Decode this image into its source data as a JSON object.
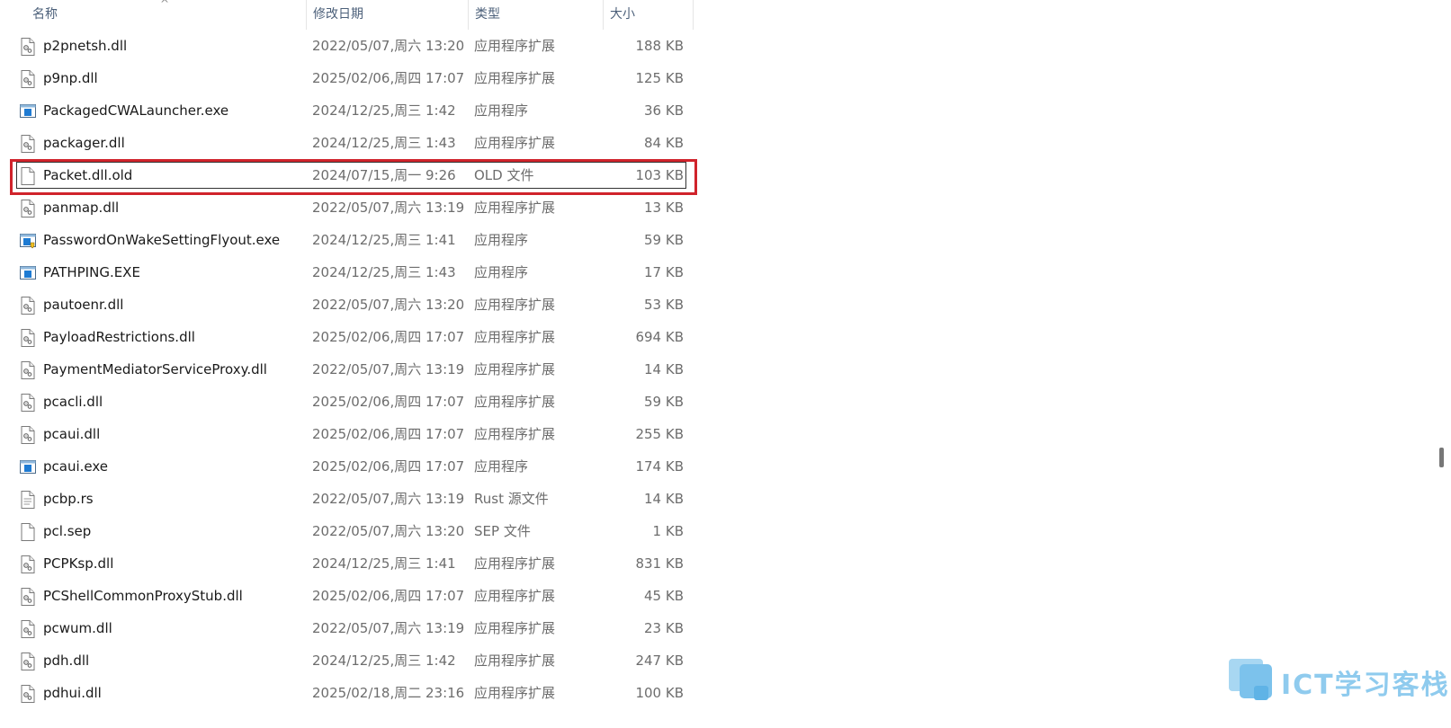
{
  "columns": {
    "name": "名称",
    "date": "修改日期",
    "type": "类型",
    "size": "大小"
  },
  "sort_indicator": "^",
  "files": [
    {
      "name": "p2pnetsh.dll",
      "date": "2022/05/07,周六 13:20",
      "type": "应用程序扩展",
      "size": "188 KB",
      "icon": "dll-icon"
    },
    {
      "name": "p9np.dll",
      "date": "2025/02/06,周四 17:07",
      "type": "应用程序扩展",
      "size": "125 KB",
      "icon": "dll-icon"
    },
    {
      "name": "PackagedCWALauncher.exe",
      "date": "2024/12/25,周三 1:42",
      "type": "应用程序",
      "size": "36 KB",
      "icon": "exe-icon"
    },
    {
      "name": "packager.dll",
      "date": "2024/12/25,周三 1:43",
      "type": "应用程序扩展",
      "size": "84 KB",
      "icon": "dll-icon"
    },
    {
      "name": "Packet.dll.old",
      "date": "2024/07/15,周一 9:26",
      "type": "OLD 文件",
      "size": "103 KB",
      "icon": "blank-file-icon",
      "selected": true
    },
    {
      "name": "panmap.dll",
      "date": "2022/05/07,周六 13:19",
      "type": "应用程序扩展",
      "size": "13 KB",
      "icon": "dll-icon"
    },
    {
      "name": "PasswordOnWakeSettingFlyout.exe",
      "date": "2024/12/25,周三 1:41",
      "type": "应用程序",
      "size": "59 KB",
      "icon": "exe-shield-icon"
    },
    {
      "name": "PATHPING.EXE",
      "date": "2024/12/25,周三 1:43",
      "type": "应用程序",
      "size": "17 KB",
      "icon": "exe-icon"
    },
    {
      "name": "pautoenr.dll",
      "date": "2022/05/07,周六 13:20",
      "type": "应用程序扩展",
      "size": "53 KB",
      "icon": "dll-icon"
    },
    {
      "name": "PayloadRestrictions.dll",
      "date": "2025/02/06,周四 17:07",
      "type": "应用程序扩展",
      "size": "694 KB",
      "icon": "dll-icon"
    },
    {
      "name": "PaymentMediatorServiceProxy.dll",
      "date": "2022/05/07,周六 13:19",
      "type": "应用程序扩展",
      "size": "14 KB",
      "icon": "dll-icon"
    },
    {
      "name": "pcacli.dll",
      "date": "2025/02/06,周四 17:07",
      "type": "应用程序扩展",
      "size": "59 KB",
      "icon": "dll-icon"
    },
    {
      "name": "pcaui.dll",
      "date": "2025/02/06,周四 17:07",
      "type": "应用程序扩展",
      "size": "255 KB",
      "icon": "dll-icon"
    },
    {
      "name": "pcaui.exe",
      "date": "2025/02/06,周四 17:07",
      "type": "应用程序",
      "size": "174 KB",
      "icon": "exe-icon"
    },
    {
      "name": "pcbp.rs",
      "date": "2022/05/07,周六 13:19",
      "type": "Rust 源文件",
      "size": "14 KB",
      "icon": "text-file-icon"
    },
    {
      "name": "pcl.sep",
      "date": "2022/05/07,周六 13:20",
      "type": "SEP 文件",
      "size": "1 KB",
      "icon": "blank-file-icon"
    },
    {
      "name": "PCPKsp.dll",
      "date": "2024/12/25,周三 1:41",
      "type": "应用程序扩展",
      "size": "831 KB",
      "icon": "dll-icon"
    },
    {
      "name": "PCShellCommonProxyStub.dll",
      "date": "2025/02/06,周四 17:07",
      "type": "应用程序扩展",
      "size": "45 KB",
      "icon": "dll-icon"
    },
    {
      "name": "pcwum.dll",
      "date": "2022/05/07,周六 13:19",
      "type": "应用程序扩展",
      "size": "23 KB",
      "icon": "dll-icon"
    },
    {
      "name": "pdh.dll",
      "date": "2024/12/25,周三 1:42",
      "type": "应用程序扩展",
      "size": "247 KB",
      "icon": "dll-icon"
    },
    {
      "name": "pdhui.dll",
      "date": "2025/02/18,周二 23:16",
      "type": "应用程序扩展",
      "size": "100 KB",
      "icon": "dll-icon"
    }
  ],
  "watermark": {
    "text": "ICT学习客栈"
  },
  "colors": {
    "highlight": "#d0232b",
    "watermark": "#8fcbee"
  }
}
